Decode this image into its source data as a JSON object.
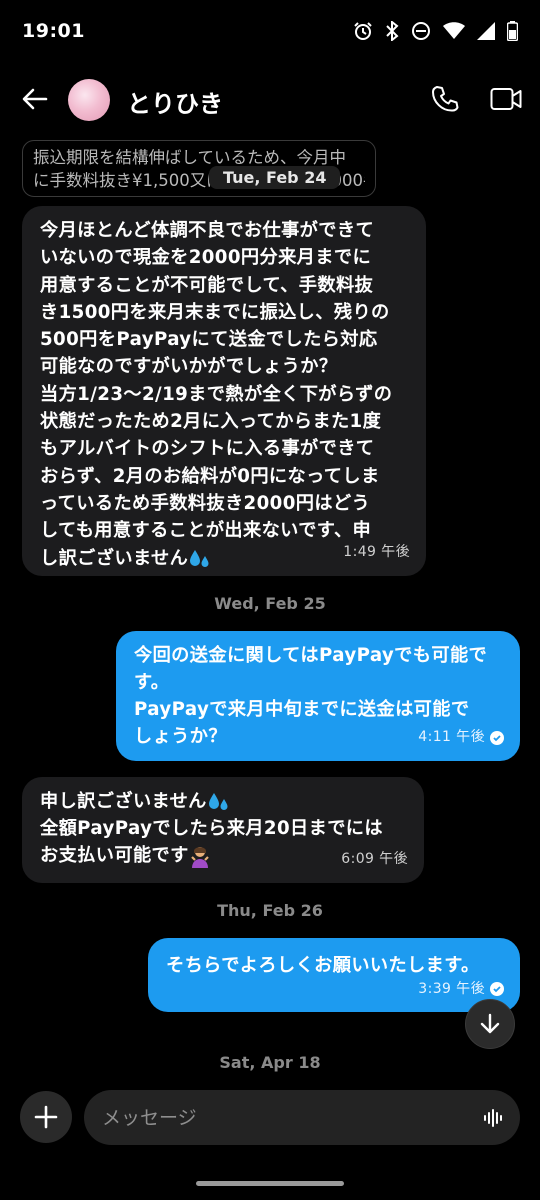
{
  "status_bar": {
    "time": "19:01",
    "icons": [
      "alarm-icon",
      "bluetooth-icon",
      "dnd-icon",
      "wifi-icon",
      "signal-icon",
      "battery-icon"
    ]
  },
  "header": {
    "contact_name": "とりひき",
    "back_icon": "arrow-left-icon",
    "call_icon": "phone-icon",
    "video_icon": "video-icon"
  },
  "quoted_message": {
    "lines": [
      "振込期限を結構伸ばしているため、今月中",
      "に手数料抜き¥1,500又は手数料込み¥2,000手..."
    ]
  },
  "date_pill": "Tue, Feb 24",
  "messages": [
    {
      "direction": "in",
      "lines": [
        "今月ほとんど体調不良でお仕事ができて",
        "いないので現金を2000円分来月までに",
        "用意することが不可能でして、手数料抜",
        "き1500円を来月末までに振込し、残りの",
        "500円をPayPayにて送金でしたら対応",
        "可能なのですがいかがでしょうか？",
        "当方1/23〜2/19まで熱が全く下がらずの",
        "状態だったため2月に入ってからまた1度",
        "もアルバイトのシフトに入る事ができて",
        "おらず、2月のお給料が0円になってしま",
        "っているため手数料抜き2000円はどう",
        "しても用意することが出来ないです、申",
        "し訳ございません"
      ],
      "emoji": "sweat-droplets-emoji",
      "time": "1:49 午後"
    },
    {
      "date_separator": "Wed, Feb 25"
    },
    {
      "direction": "out",
      "lines": [
        "今回の送金に関してはPayPayでも可能で",
        "す。",
        "PayPayで来月中旬までに送金は可能で",
        "しょうか？"
      ],
      "time": "4:11 午後"
    },
    {
      "direction": "in",
      "lines": [
        "申し訳ございません",
        "全額PayPayでしたら来月20日までには",
        "お支払い可能です"
      ],
      "time": "6:09 午後"
    },
    {
      "date_separator": "Thu, Feb 26"
    },
    {
      "direction": "out",
      "lines": [
        "そちらでよろしくお願いいたします。"
      ],
      "time": "3:39 午後"
    },
    {
      "date_separator": "Sat, Apr 18"
    }
  ],
  "composer": {
    "placeholder": "メッセージ",
    "add_icon": "plus-icon",
    "voice_icon": "waveform-icon"
  },
  "colors": {
    "outgoing_bubble": "#1d9bf0",
    "incoming_bubble": "#1c1c1e",
    "background": "#000000"
  }
}
